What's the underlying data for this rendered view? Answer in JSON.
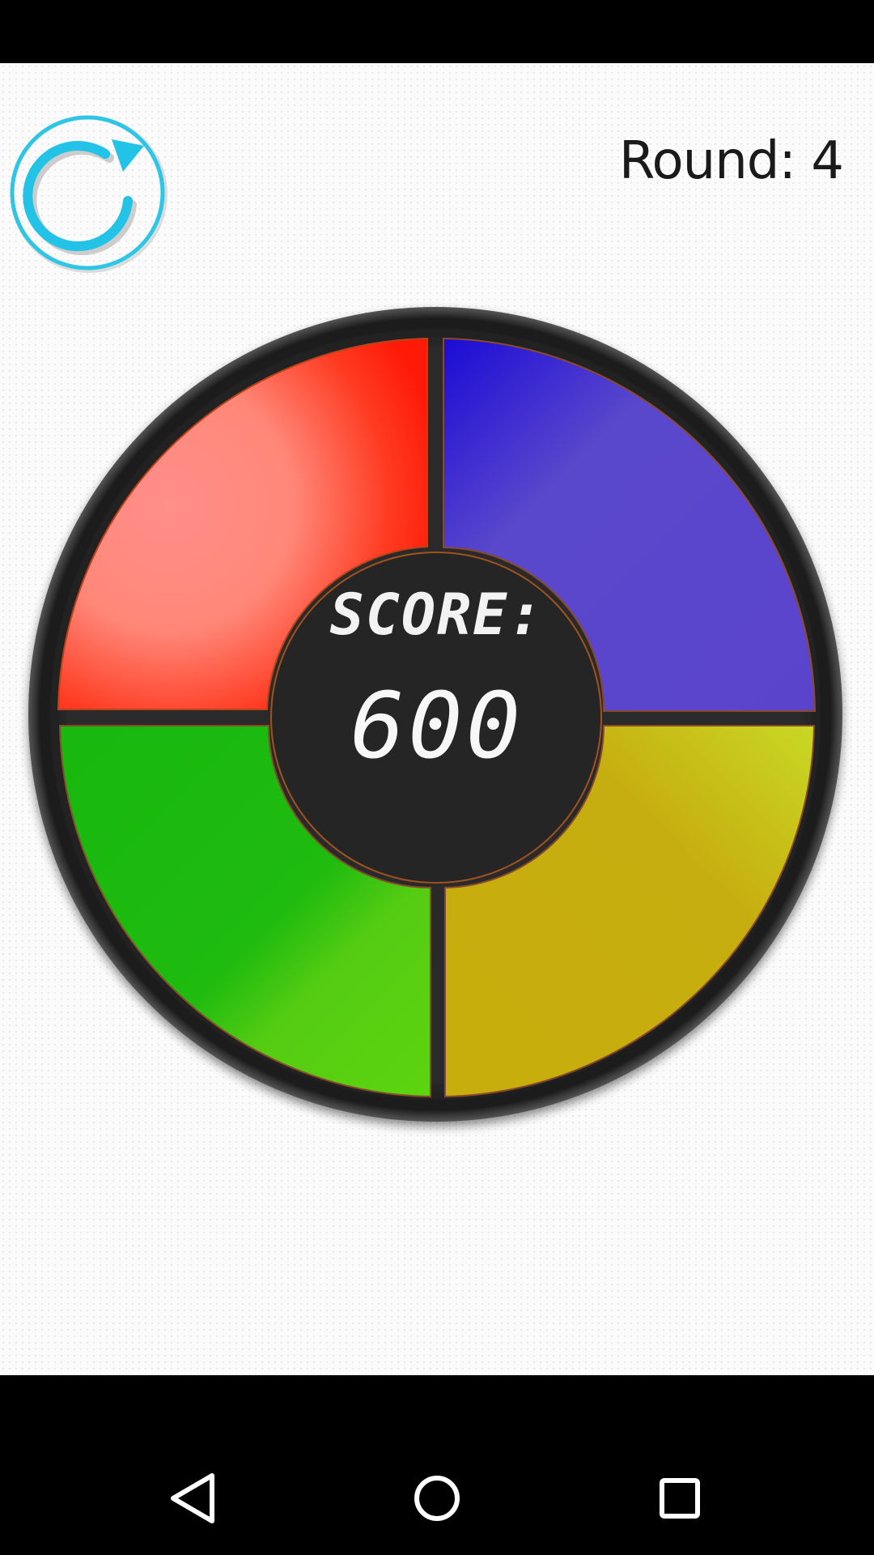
{
  "status_bar": {},
  "header": {
    "round_label": "Round: 4",
    "restart_icon": "restart-icon"
  },
  "board": {
    "score_title": "SCORE:",
    "score_value": "600",
    "pads": [
      {
        "name": "red-pad",
        "color": "#ff2a1a"
      },
      {
        "name": "blue-pad",
        "color": "#5a48cc"
      },
      {
        "name": "green-pad",
        "color": "#22c012"
      },
      {
        "name": "yellow-pad",
        "color": "#c8b418"
      }
    ]
  },
  "nav": {
    "back_icon": "back-triangle-icon",
    "home_icon": "home-circle-icon",
    "recents_icon": "recents-square-icon"
  }
}
